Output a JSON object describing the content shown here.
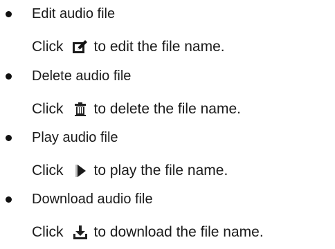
{
  "items": [
    {
      "title": "Edit audio file",
      "click_label": "Click",
      "icon_name": "edit-icon",
      "description": "to edit the file name."
    },
    {
      "title": "Delete audio file",
      "click_label": "Click",
      "icon_name": "trash-icon",
      "description": "to delete the file name."
    },
    {
      "title": "Play audio file",
      "click_label": "Click",
      "icon_name": "play-icon",
      "description": "to play the file name."
    },
    {
      "title": "Download audio file",
      "click_label": "Click",
      "icon_name": "download-icon",
      "description": "to download the file name."
    }
  ]
}
